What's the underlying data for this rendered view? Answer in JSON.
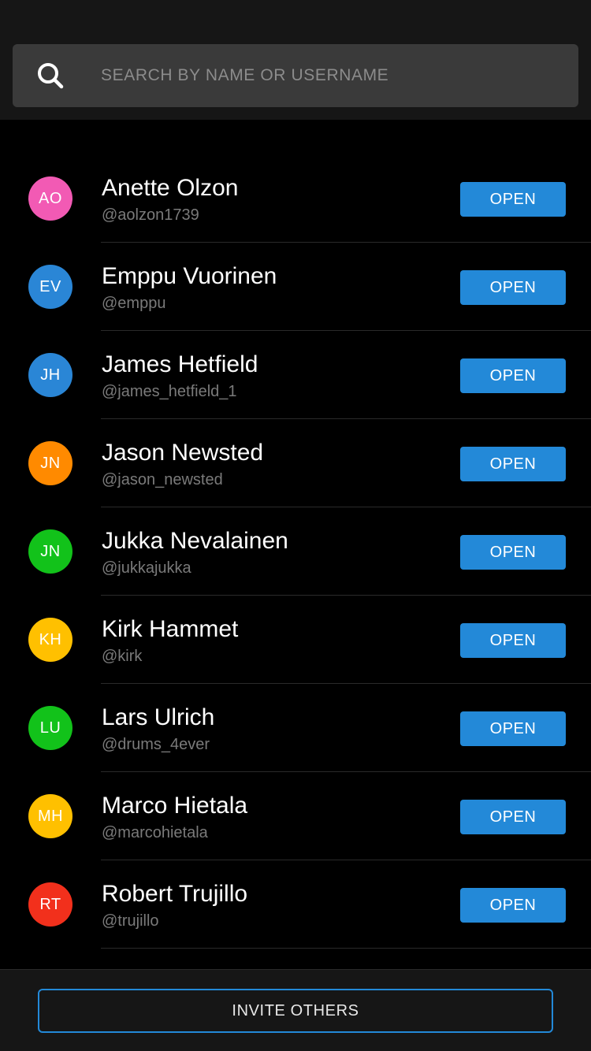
{
  "search": {
    "placeholder": "SEARCH BY NAME OR USERNAME",
    "icon": "search-icon"
  },
  "users": [
    {
      "initials": "AO",
      "name": "Anette Olzon",
      "username": "@aolzon1739",
      "avatar_color": "#f25ab4",
      "button": "OPEN"
    },
    {
      "initials": "EV",
      "name": "Emppu Vuorinen",
      "username": "@emppu",
      "avatar_color": "#2a86d6",
      "button": "OPEN"
    },
    {
      "initials": "JH",
      "name": "James Hetfield",
      "username": "@james_hetfield_1",
      "avatar_color": "#2a86d6",
      "button": "OPEN"
    },
    {
      "initials": "JN",
      "name": "Jason Newsted",
      "username": "@jason_newsted",
      "avatar_color": "#ff8a00",
      "button": "OPEN"
    },
    {
      "initials": "JN",
      "name": "Jukka Nevalainen",
      "username": "@jukkajukka",
      "avatar_color": "#12c21a",
      "button": "OPEN"
    },
    {
      "initials": "KH",
      "name": "Kirk Hammet",
      "username": "@kirk",
      "avatar_color": "#ffc000",
      "button": "OPEN"
    },
    {
      "initials": "LU",
      "name": "Lars Ulrich",
      "username": "@drums_4ever",
      "avatar_color": "#12c21a",
      "button": "OPEN"
    },
    {
      "initials": "MH",
      "name": "Marco Hietala",
      "username": "@marcohietala",
      "avatar_color": "#ffc000",
      "button": "OPEN"
    },
    {
      "initials": "RT",
      "name": "Robert Trujillo",
      "username": "@trujillo",
      "avatar_color": "#f2301c",
      "button": "OPEN"
    }
  ],
  "footer": {
    "invite_label": "INVITE OTHERS"
  },
  "colors": {
    "accent": "#2389d8",
    "background": "#000000",
    "header_background": "#161616",
    "search_background": "#3a3a3a"
  }
}
